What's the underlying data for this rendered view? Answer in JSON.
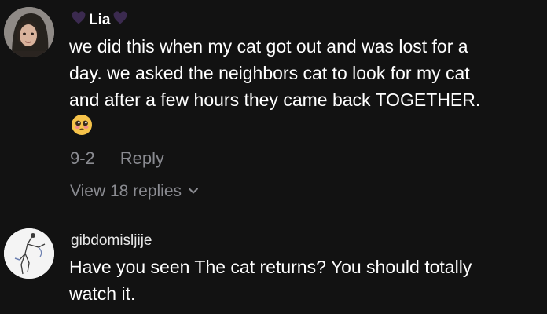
{
  "comments": [
    {
      "username": "Lia",
      "username_decoration": "purple-heart-icon",
      "text": "we did this when my cat got out and was lost for a\nday. we asked the neighbors cat to look for my cat\nand after a few hours they came back TOGETHER.",
      "emoji": "pleading-face-icon",
      "date": "9-2",
      "reply_label": "Reply",
      "view_replies_label": "View 18 replies"
    },
    {
      "username": "gibdomisljije",
      "text": "Have you seen The cat returns? You should totally\nwatch it."
    }
  ],
  "colors": {
    "background": "#121212",
    "text_primary": "#ffffff",
    "text_secondary": "#8a8b91",
    "heart": "#3b2a4f"
  }
}
